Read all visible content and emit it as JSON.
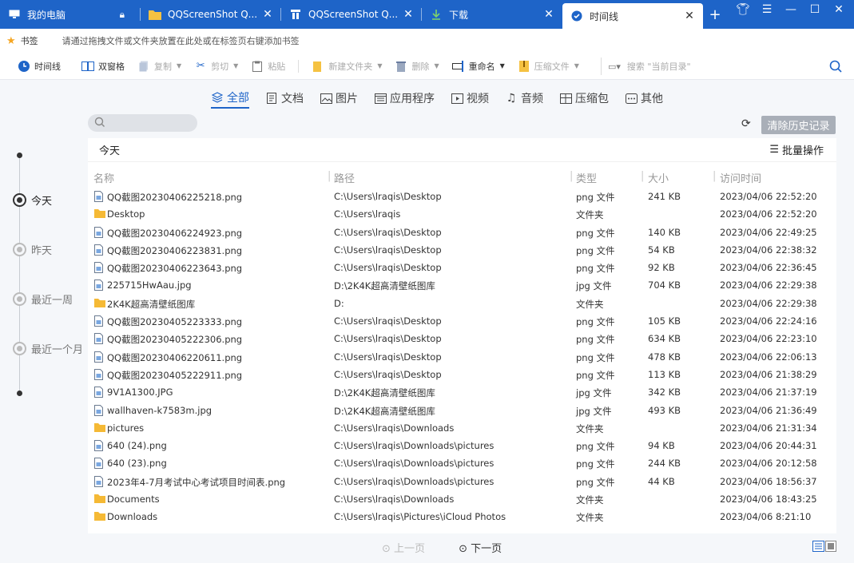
{
  "tabs": [
    {
      "label": "我的电脑",
      "icon": "monitor-icon",
      "closable": false
    },
    {
      "label": "QQScreenShot Q...",
      "icon": "folder-icon",
      "closable": true
    },
    {
      "label": "QQScreenShot Q...",
      "icon": "folder-blue-icon",
      "closable": true
    },
    {
      "label": "下载",
      "icon": "download-icon",
      "closable": true
    },
    {
      "label": "时间线",
      "icon": "timeline-icon",
      "closable": true
    }
  ],
  "bookmarks": {
    "label": "书签",
    "hint": "请通过拖拽文件或文件夹放置在此处或在标签页右键添加书签"
  },
  "toolbar": {
    "timeline": "时间线",
    "dual": "双窗格",
    "copy": "复制",
    "cut": "剪切",
    "paste": "粘贴",
    "newfolder": "新建文件夹",
    "delete": "删除",
    "rename": "重命名",
    "compress": "压缩文件",
    "search_placeholder": "搜索 \"当前目录\""
  },
  "filters": [
    "全部",
    "文档",
    "图片",
    "应用程序",
    "视频",
    "音频",
    "压缩包",
    "其他"
  ],
  "clear_history": "清除历史记录",
  "timeline": [
    "今天",
    "昨天",
    "最近一周",
    "最近一个月"
  ],
  "panel": {
    "day": "今天",
    "batch": "批量操作",
    "columns": {
      "name": "名称",
      "path": "路径",
      "type": "类型",
      "size": "大小",
      "time": "访问时间"
    }
  },
  "files": [
    {
      "name": "QQ截图20230406225218.png",
      "path": "C:\\Users\\lraqis\\Desktop",
      "type": "png 文件",
      "size": "241 KB",
      "time": "2023/04/06 22:52:20",
      "kind": "file"
    },
    {
      "name": "Desktop",
      "path": "C:\\Users\\lraqis",
      "type": "文件夹",
      "size": "",
      "time": "2023/04/06 22:52:20",
      "kind": "folder"
    },
    {
      "name": "QQ截图20230406224923.png",
      "path": "C:\\Users\\lraqis\\Desktop",
      "type": "png 文件",
      "size": "140 KB",
      "time": "2023/04/06 22:49:25",
      "kind": "file"
    },
    {
      "name": "QQ截图20230406223831.png",
      "path": "C:\\Users\\lraqis\\Desktop",
      "type": "png 文件",
      "size": "54 KB",
      "time": "2023/04/06 22:38:32",
      "kind": "file"
    },
    {
      "name": "QQ截图20230406223643.png",
      "path": "C:\\Users\\lraqis\\Desktop",
      "type": "png 文件",
      "size": "92 KB",
      "time": "2023/04/06 22:36:45",
      "kind": "file"
    },
    {
      "name": "225715HwAau.jpg",
      "path": "D:\\2K4K超高清壁纸图库",
      "type": "jpg 文件",
      "size": "704 KB",
      "time": "2023/04/06 22:29:38",
      "kind": "file"
    },
    {
      "name": "2K4K超高清壁纸图库",
      "path": "D:",
      "type": "文件夹",
      "size": "",
      "time": "2023/04/06 22:29:38",
      "kind": "folder"
    },
    {
      "name": "QQ截图20230405223333.png",
      "path": "C:\\Users\\lraqis\\Desktop",
      "type": "png 文件",
      "size": "105 KB",
      "time": "2023/04/06 22:24:16",
      "kind": "file"
    },
    {
      "name": "QQ截图20230405222306.png",
      "path": "C:\\Users\\lraqis\\Desktop",
      "type": "png 文件",
      "size": "634 KB",
      "time": "2023/04/06 22:23:10",
      "kind": "file"
    },
    {
      "name": "QQ截图20230406220611.png",
      "path": "C:\\Users\\lraqis\\Desktop",
      "type": "png 文件",
      "size": "478 KB",
      "time": "2023/04/06 22:06:13",
      "kind": "file"
    },
    {
      "name": "QQ截图20230405222911.png",
      "path": "C:\\Users\\lraqis\\Desktop",
      "type": "png 文件",
      "size": "113 KB",
      "time": "2023/04/06 21:38:29",
      "kind": "file"
    },
    {
      "name": "9V1A1300.JPG",
      "path": "D:\\2K4K超高清壁纸图库",
      "type": "jpg 文件",
      "size": "342 KB",
      "time": "2023/04/06 21:37:19",
      "kind": "file"
    },
    {
      "name": "wallhaven-k7583m.jpg",
      "path": "D:\\2K4K超高清壁纸图库",
      "type": "jpg 文件",
      "size": "493 KB",
      "time": "2023/04/06 21:36:49",
      "kind": "file"
    },
    {
      "name": "pictures",
      "path": "C:\\Users\\lraqis\\Downloads",
      "type": "文件夹",
      "size": "",
      "time": "2023/04/06 21:31:34",
      "kind": "folder"
    },
    {
      "name": "640 (24).png",
      "path": "C:\\Users\\lraqis\\Downloads\\pictures",
      "type": "png 文件",
      "size": "94 KB",
      "time": "2023/04/06 20:44:31",
      "kind": "file"
    },
    {
      "name": "640 (23).png",
      "path": "C:\\Users\\lraqis\\Downloads\\pictures",
      "type": "png 文件",
      "size": "244 KB",
      "time": "2023/04/06 20:12:58",
      "kind": "file"
    },
    {
      "name": "2023年4-7月考试中心考试项目时间表.png",
      "path": "C:\\Users\\lraqis\\Downloads\\pictures",
      "type": "png 文件",
      "size": "44 KB",
      "time": "2023/04/06 18:56:37",
      "kind": "file"
    },
    {
      "name": "Documents",
      "path": "C:\\Users\\lraqis\\Downloads",
      "type": "文件夹",
      "size": "",
      "time": "2023/04/06 18:43:25",
      "kind": "folder"
    },
    {
      "name": "Downloads",
      "path": "C:\\Users\\lraqis\\Pictures\\iCloud Photos",
      "type": "文件夹",
      "size": "",
      "time": "2023/04/06 8:21:10",
      "kind": "folder"
    }
  ],
  "pager": {
    "prev": "上一页",
    "next": "下一页"
  },
  "colors": {
    "accent": "#1e64c8",
    "folder": "#f5b935"
  }
}
